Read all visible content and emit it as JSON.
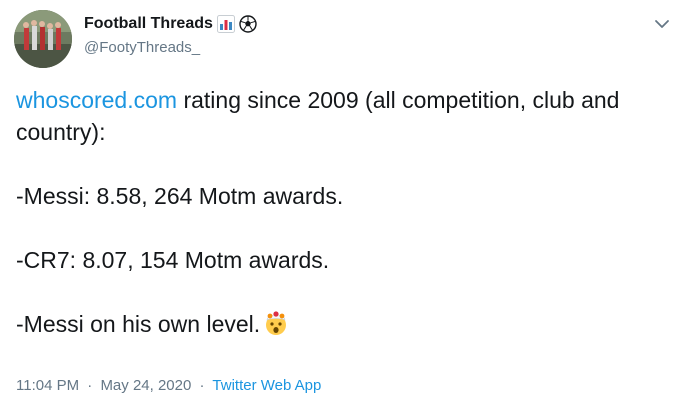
{
  "author": {
    "display_name": "Football Threads",
    "handle": "@FootyThreads_",
    "name_emojis": [
      "bar-chart-icon",
      "soccer-ball-icon"
    ]
  },
  "tweet": {
    "link_text": "whoscored.com",
    "line1_rest": " rating since 2009 (all competition, club and country):",
    "stat1": "-Messi: 8.58, 264 Motm awards.",
    "stat2": "-CR7: 8.07, 154 Motm awards.",
    "closing": "-Messi on his own level.",
    "closing_emoji": "exploding-head-icon"
  },
  "meta": {
    "time": "11:04 PM",
    "date": "May 24, 2020",
    "separator": "·",
    "source_app": "Twitter Web App"
  },
  "colors": {
    "link": "#1b95e0",
    "secondary_text": "#657786",
    "primary_text": "#14171a"
  }
}
